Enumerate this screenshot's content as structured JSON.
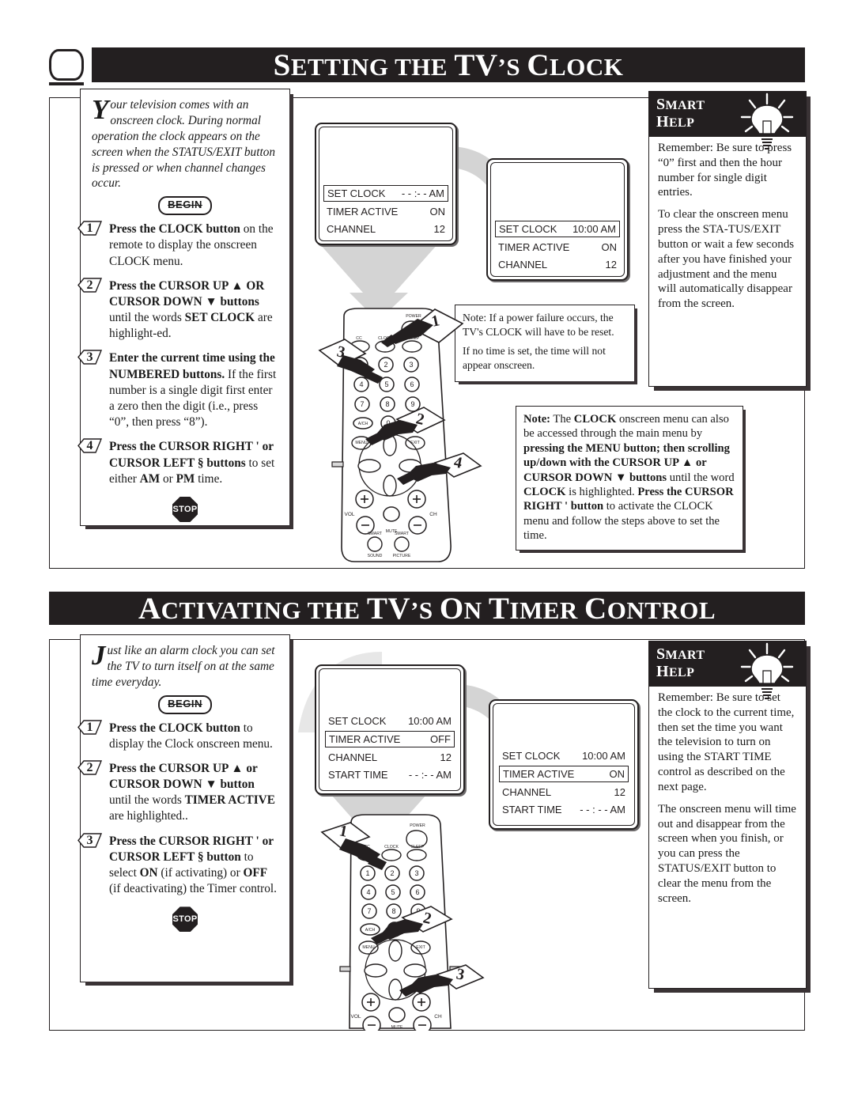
{
  "page": {
    "sections": [
      {
        "id": "setting-clock",
        "title_parts": [
          "S",
          "ETTING THE ",
          "TV",
          "’",
          "S ",
          "C",
          "LOCK"
        ],
        "title_plain": "SETTING THE TV’S CLOCK",
        "intro": {
          "dropcap": "Y",
          "text": "our television comes with an onscreen clock. During normal operation the clock appears on the screen when the STATUS/EXIT button is pressed or when channel changes occur."
        },
        "begin_label": "BEGIN",
        "stop_label": "STOP",
        "steps": [
          {
            "num": "1",
            "html": "<b>Press the CLOCK button</b> on the remote to display the onscreen CLOCK menu."
          },
          {
            "num": "2",
            "html": "<b>Press the CURSOR UP ▲ OR CURSOR DOWN ▼ buttons</b> until the words <b>SET CLOCK</b> are highlight-ed."
          },
          {
            "num": "3",
            "html": "<b>Enter the current time using the NUMBERED buttons.</b> If the first number is a single digit first enter a zero then the digit (i.e., press “0”, then press “8”)."
          },
          {
            "num": "4",
            "html": "<b>Press the CURSOR RIGHT '  or CURSOR LEFT §  buttons</b> to set either <b>AM</b> or <b>PM</b> time."
          }
        ],
        "screens": [
          {
            "id": "clock-screen-before",
            "rows": [
              {
                "label": "SET CLOCK",
                "value": "- - :- - AM",
                "highlighted": true
              },
              {
                "label": "TIMER ACTIVE",
                "value": "ON",
                "highlighted": false
              },
              {
                "label": "CHANNEL",
                "value": "12",
                "highlighted": false
              }
            ]
          },
          {
            "id": "clock-screen-after",
            "rows": [
              {
                "label": "SET CLOCK",
                "value": "10:00  AM",
                "highlighted": true
              },
              {
                "label": "TIMER ACTIVE",
                "value": "ON",
                "highlighted": false
              },
              {
                "label": "CHANNEL",
                "value": "12",
                "highlighted": false
              }
            ]
          }
        ],
        "notes": [
          {
            "id": "power-failure-note",
            "paragraphs": [
              "Note: If a power failure occurs, the TV's CLOCK will have to be reset.",
              "If no time is set, the time will not appear onscreen."
            ]
          }
        ],
        "note_rich": {
          "id": "clock-menu-note",
          "html": "<b>Note:</b> The <b>CLOCK</b> onscreen menu can also be accessed through the main menu by <b>pressing the MENU button; then scrolling up/down with the CURSOR UP ▲ or CURSOR DOWN ▼ buttons</b> until the word <b>CLOCK</b> is highlighted. <b>Press the CURSOR RIGHT '   button</b> to activate the CLOCK menu and follow the steps above to set the time."
        },
        "smart_help": {
          "title_line1": "SMART",
          "title_line2": "HELP",
          "paragraphs": [
            "Remember: Be sure to press “0” first and then the hour number for single digit entries.",
            "To clear the onscreen menu press the STA-TUS/EXIT button or wait a few seconds after you have finished your adjustment and the menu will automatically disappear from the screen."
          ]
        },
        "remote": {
          "id": "remote-clock",
          "callouts": [
            "1",
            "3",
            "2",
            "4"
          ],
          "top_buttons": [
            "CC",
            "CLOCK",
            "SLEEP"
          ],
          "power_label": "POWER",
          "keypad": [
            "1",
            "2",
            "3",
            "4",
            "5",
            "6",
            "7",
            "8",
            "9"
          ],
          "extra_keys": [
            "A/CH",
            "0"
          ],
          "menu_label": "MENU",
          "exit_label": "EXIT",
          "vol_label": "VOL",
          "ch_label": "CH",
          "mute_label": "MUTE",
          "smart_sound": [
            "SMART",
            "SOUND"
          ],
          "smart_picture": [
            "SMART",
            "PICTURE"
          ]
        }
      },
      {
        "id": "activating-timer",
        "title_plain": "ACTIVATING THE TV’S ON TIMER CONTROL",
        "intro": {
          "dropcap": "J",
          "text": "ust like an alarm clock you can set the TV to turn itself on at the same time everyday."
        },
        "begin_label": "BEGIN",
        "stop_label": "STOP",
        "steps": [
          {
            "num": "1",
            "html": "<b>Press the CLOCK button</b> to display the Clock onscreen menu."
          },
          {
            "num": "2",
            "html": "<b>Press the CURSOR UP ▲ or CURSOR DOWN ▼ button</b> until the words <b>TIMER ACTIVE</b> are highlighted.."
          },
          {
            "num": "3",
            "html": "<b>Press the CURSOR RIGHT '   or CURSOR LEFT §  button</b> to select <b>ON</b> (if activating) or <b>OFF</b> (if deactivating) the Timer control."
          }
        ],
        "screens": [
          {
            "id": "timer-screen-before",
            "rows": [
              {
                "label": "SET CLOCK",
                "value": "10:00 AM",
                "highlighted": false
              },
              {
                "label": "TIMER ACTIVE",
                "value": "OFF",
                "highlighted": true
              },
              {
                "label": "CHANNEL",
                "value": "12",
                "highlighted": false
              },
              {
                "label": "START TIME",
                "value": "- - :- - AM",
                "highlighted": false
              }
            ]
          },
          {
            "id": "timer-screen-after",
            "rows": [
              {
                "label": "SET CLOCK",
                "value": "10:00  AM",
                "highlighted": false
              },
              {
                "label": "TIMER ACTIVE",
                "value": "ON",
                "highlighted": true
              },
              {
                "label": "CHANNEL",
                "value": "12",
                "highlighted": false
              },
              {
                "label": "START TIME",
                "value": "- - : - - AM",
                "highlighted": false
              }
            ]
          }
        ],
        "smart_help": {
          "title_line1": "SMART",
          "title_line2": "HELP",
          "paragraphs": [
            "Remember: Be sure to set the clock to the current time, then set the time you want the television to turn on using the START TIME control as described on the next page.",
            "The onscreen menu will time out and disappear from the screen when you finish, or you can press the STATUS/EXIT button to clear the menu from the screen."
          ]
        },
        "remote": {
          "id": "remote-timer",
          "callouts": [
            "1",
            "2",
            "3"
          ],
          "top_buttons": [
            "CC",
            "CLOCK",
            "SLEEP"
          ],
          "power_label": "POWER",
          "keypad": [
            "1",
            "2",
            "3",
            "4",
            "5",
            "6",
            "7",
            "8",
            "9"
          ],
          "extra_keys": [
            "A/CH",
            "0"
          ],
          "menu_label": "MENU",
          "exit_label": "EXIT",
          "vol_label": "VOL",
          "ch_label": "CH",
          "mute_label": "MUTE"
        }
      }
    ],
    "colors": {
      "ink": "#231f20",
      "shadow": "#3a3335",
      "swoosh": "#d4d4d4",
      "paper": "#ffffff"
    }
  }
}
